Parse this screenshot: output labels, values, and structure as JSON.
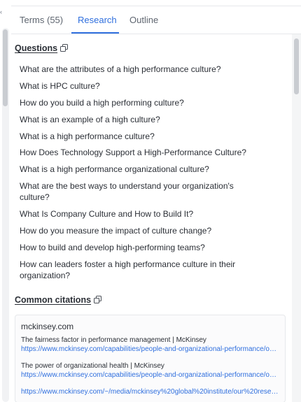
{
  "tabs": [
    {
      "label": "Terms (55)"
    },
    {
      "label": "Research"
    },
    {
      "label": "Outline"
    }
  ],
  "questions": {
    "title": "Questions",
    "items": [
      "What are the attributes of a high performance culture?",
      "What is HPC culture?",
      "How do you build a high performing culture?",
      "What is an example of a high culture?",
      "What is a high performance culture?",
      "How Does Technology Support a High-Performance Culture?",
      "What is a high performance organizational culture?",
      "What are the best ways to understand your organization's culture?",
      "What Is Company Culture and How to Build It?",
      "How do you measure the impact of culture change?",
      "How to build and develop high-performing teams?",
      "How can leaders foster a high performance culture in their organization?"
    ]
  },
  "citations": {
    "title": "Common citations",
    "domain": "mckinsey.com",
    "items": [
      {
        "title": "The fairness factor in performance management | McKinsey",
        "url": "https://www.mckinsey.com/capabilities/people-and-organizational-performance/our-insights/the-fairness-factor-in-performance-management"
      },
      {
        "title": "The power of organizational health | McKinsey",
        "url": "https://www.mckinsey.com/capabilities/people-and-organizational-performance/our-insights/the-power-of-organizational-health"
      },
      {
        "title": "",
        "url": "https://www.mckinsey.com/~/media/mckinsey%20global%20institute/our%20research"
      }
    ]
  }
}
